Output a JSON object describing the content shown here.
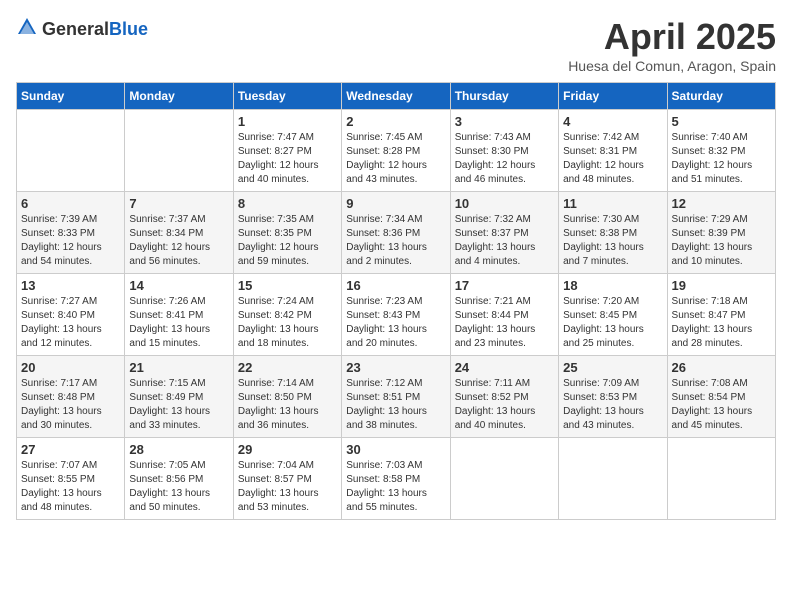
{
  "header": {
    "logo_general": "General",
    "logo_blue": "Blue",
    "month_title": "April 2025",
    "location": "Huesa del Comun, Aragon, Spain"
  },
  "days_of_week": [
    "Sunday",
    "Monday",
    "Tuesday",
    "Wednesday",
    "Thursday",
    "Friday",
    "Saturday"
  ],
  "weeks": [
    [
      {
        "day": "",
        "sunrise": "",
        "sunset": "",
        "daylight": ""
      },
      {
        "day": "",
        "sunrise": "",
        "sunset": "",
        "daylight": ""
      },
      {
        "day": "1",
        "sunrise": "Sunrise: 7:47 AM",
        "sunset": "Sunset: 8:27 PM",
        "daylight": "Daylight: 12 hours and 40 minutes."
      },
      {
        "day": "2",
        "sunrise": "Sunrise: 7:45 AM",
        "sunset": "Sunset: 8:28 PM",
        "daylight": "Daylight: 12 hours and 43 minutes."
      },
      {
        "day": "3",
        "sunrise": "Sunrise: 7:43 AM",
        "sunset": "Sunset: 8:30 PM",
        "daylight": "Daylight: 12 hours and 46 minutes."
      },
      {
        "day": "4",
        "sunrise": "Sunrise: 7:42 AM",
        "sunset": "Sunset: 8:31 PM",
        "daylight": "Daylight: 12 hours and 48 minutes."
      },
      {
        "day": "5",
        "sunrise": "Sunrise: 7:40 AM",
        "sunset": "Sunset: 8:32 PM",
        "daylight": "Daylight: 12 hours and 51 minutes."
      }
    ],
    [
      {
        "day": "6",
        "sunrise": "Sunrise: 7:39 AM",
        "sunset": "Sunset: 8:33 PM",
        "daylight": "Daylight: 12 hours and 54 minutes."
      },
      {
        "day": "7",
        "sunrise": "Sunrise: 7:37 AM",
        "sunset": "Sunset: 8:34 PM",
        "daylight": "Daylight: 12 hours and 56 minutes."
      },
      {
        "day": "8",
        "sunrise": "Sunrise: 7:35 AM",
        "sunset": "Sunset: 8:35 PM",
        "daylight": "Daylight: 12 hours and 59 minutes."
      },
      {
        "day": "9",
        "sunrise": "Sunrise: 7:34 AM",
        "sunset": "Sunset: 8:36 PM",
        "daylight": "Daylight: 13 hours and 2 minutes."
      },
      {
        "day": "10",
        "sunrise": "Sunrise: 7:32 AM",
        "sunset": "Sunset: 8:37 PM",
        "daylight": "Daylight: 13 hours and 4 minutes."
      },
      {
        "day": "11",
        "sunrise": "Sunrise: 7:30 AM",
        "sunset": "Sunset: 8:38 PM",
        "daylight": "Daylight: 13 hours and 7 minutes."
      },
      {
        "day": "12",
        "sunrise": "Sunrise: 7:29 AM",
        "sunset": "Sunset: 8:39 PM",
        "daylight": "Daylight: 13 hours and 10 minutes."
      }
    ],
    [
      {
        "day": "13",
        "sunrise": "Sunrise: 7:27 AM",
        "sunset": "Sunset: 8:40 PM",
        "daylight": "Daylight: 13 hours and 12 minutes."
      },
      {
        "day": "14",
        "sunrise": "Sunrise: 7:26 AM",
        "sunset": "Sunset: 8:41 PM",
        "daylight": "Daylight: 13 hours and 15 minutes."
      },
      {
        "day": "15",
        "sunrise": "Sunrise: 7:24 AM",
        "sunset": "Sunset: 8:42 PM",
        "daylight": "Daylight: 13 hours and 18 minutes."
      },
      {
        "day": "16",
        "sunrise": "Sunrise: 7:23 AM",
        "sunset": "Sunset: 8:43 PM",
        "daylight": "Daylight: 13 hours and 20 minutes."
      },
      {
        "day": "17",
        "sunrise": "Sunrise: 7:21 AM",
        "sunset": "Sunset: 8:44 PM",
        "daylight": "Daylight: 13 hours and 23 minutes."
      },
      {
        "day": "18",
        "sunrise": "Sunrise: 7:20 AM",
        "sunset": "Sunset: 8:45 PM",
        "daylight": "Daylight: 13 hours and 25 minutes."
      },
      {
        "day": "19",
        "sunrise": "Sunrise: 7:18 AM",
        "sunset": "Sunset: 8:47 PM",
        "daylight": "Daylight: 13 hours and 28 minutes."
      }
    ],
    [
      {
        "day": "20",
        "sunrise": "Sunrise: 7:17 AM",
        "sunset": "Sunset: 8:48 PM",
        "daylight": "Daylight: 13 hours and 30 minutes."
      },
      {
        "day": "21",
        "sunrise": "Sunrise: 7:15 AM",
        "sunset": "Sunset: 8:49 PM",
        "daylight": "Daylight: 13 hours and 33 minutes."
      },
      {
        "day": "22",
        "sunrise": "Sunrise: 7:14 AM",
        "sunset": "Sunset: 8:50 PM",
        "daylight": "Daylight: 13 hours and 36 minutes."
      },
      {
        "day": "23",
        "sunrise": "Sunrise: 7:12 AM",
        "sunset": "Sunset: 8:51 PM",
        "daylight": "Daylight: 13 hours and 38 minutes."
      },
      {
        "day": "24",
        "sunrise": "Sunrise: 7:11 AM",
        "sunset": "Sunset: 8:52 PM",
        "daylight": "Daylight: 13 hours and 40 minutes."
      },
      {
        "day": "25",
        "sunrise": "Sunrise: 7:09 AM",
        "sunset": "Sunset: 8:53 PM",
        "daylight": "Daylight: 13 hours and 43 minutes."
      },
      {
        "day": "26",
        "sunrise": "Sunrise: 7:08 AM",
        "sunset": "Sunset: 8:54 PM",
        "daylight": "Daylight: 13 hours and 45 minutes."
      }
    ],
    [
      {
        "day": "27",
        "sunrise": "Sunrise: 7:07 AM",
        "sunset": "Sunset: 8:55 PM",
        "daylight": "Daylight: 13 hours and 48 minutes."
      },
      {
        "day": "28",
        "sunrise": "Sunrise: 7:05 AM",
        "sunset": "Sunset: 8:56 PM",
        "daylight": "Daylight: 13 hours and 50 minutes."
      },
      {
        "day": "29",
        "sunrise": "Sunrise: 7:04 AM",
        "sunset": "Sunset: 8:57 PM",
        "daylight": "Daylight: 13 hours and 53 minutes."
      },
      {
        "day": "30",
        "sunrise": "Sunrise: 7:03 AM",
        "sunset": "Sunset: 8:58 PM",
        "daylight": "Daylight: 13 hours and 55 minutes."
      },
      {
        "day": "",
        "sunrise": "",
        "sunset": "",
        "daylight": ""
      },
      {
        "day": "",
        "sunrise": "",
        "sunset": "",
        "daylight": ""
      },
      {
        "day": "",
        "sunrise": "",
        "sunset": "",
        "daylight": ""
      }
    ]
  ]
}
